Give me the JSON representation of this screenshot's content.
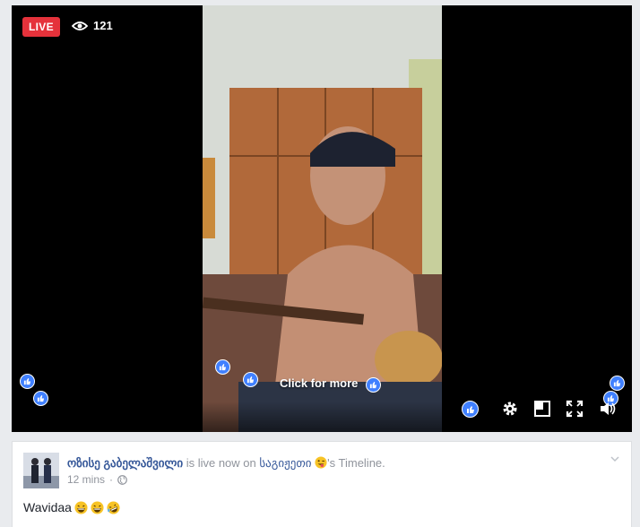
{
  "video": {
    "live_label": "LIVE",
    "viewer_count": "121",
    "click_more": "Click for more"
  },
  "post": {
    "author": "ოზისე გაბელაშვილი",
    "verb_text": "is live now on",
    "timeline_owner": "საგიჟეთი",
    "timeline_suffix": "'s Timeline.",
    "timestamp": "12 mins",
    "separator": "·",
    "message": "Wavidaa"
  },
  "colors": {
    "live_red": "#e5323b",
    "like_blue": "#4080ff",
    "link_blue": "#365899"
  },
  "icons": [
    "eye-icon",
    "like-icon",
    "gear-icon",
    "minimize-icon",
    "fullscreen-icon",
    "volume-icon",
    "globe-icon",
    "chevron-down-icon",
    "grinning-emoji",
    "rofl-emoji",
    "winking-tongue-emoji"
  ]
}
